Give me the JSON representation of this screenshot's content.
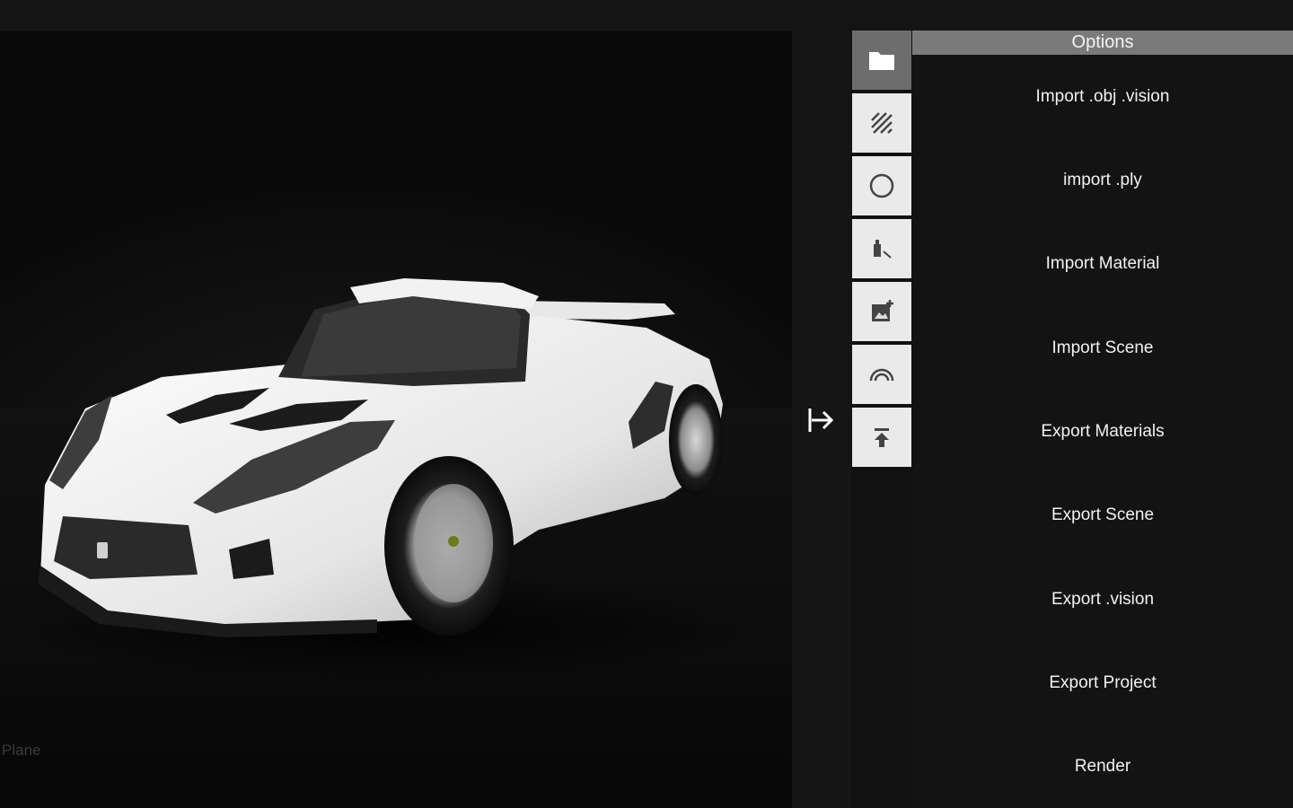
{
  "viewport": {
    "object_label": "Plane"
  },
  "options": {
    "title": "Options",
    "items": [
      "Import .obj .vision",
      "import .ply",
      "Import Material",
      "Import Scene",
      "Export Materials",
      "Export Scene",
      "Export .vision",
      "Export Project",
      "Render"
    ]
  },
  "toolbar": {
    "tools": [
      "folder-icon",
      "texture-icon",
      "circle-icon",
      "light-icon",
      "image-add-icon",
      "rainbow-icon",
      "upload-icon"
    ],
    "active_index": 0
  },
  "colors": {
    "background": "#111111",
    "panel_header": "#7a7a7a",
    "tool_bg": "#eaeaea",
    "tool_active": "#6d6d6d"
  }
}
